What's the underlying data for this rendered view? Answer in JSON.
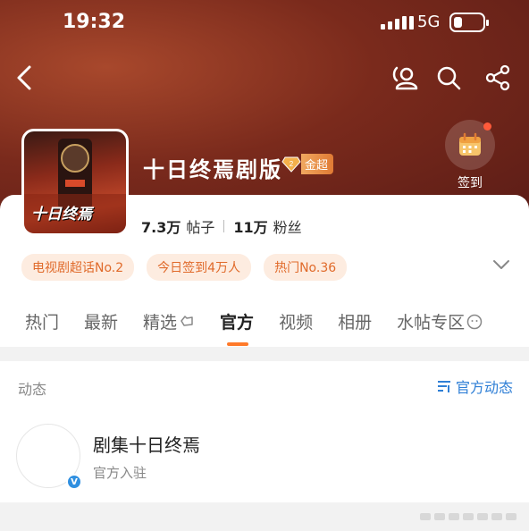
{
  "status": {
    "time": "19:32",
    "network": "5G"
  },
  "header": {
    "back_icon": "chevron-left-icon",
    "icons": [
      "members-icon",
      "search-icon",
      "share-icon"
    ]
  },
  "topic": {
    "title": "十日终焉剧版",
    "badge": "金超",
    "posts_count": "7.3万",
    "posts_label": "帖子",
    "fans_count": "11万",
    "fans_label": "粉丝",
    "checkin_label": "签到",
    "poster_text": "十日终焉"
  },
  "tags": [
    "电视剧超话No.2",
    "今日签到4万人",
    "热门No.36"
  ],
  "tabs": [
    "热门",
    "最新",
    "精选",
    "官方",
    "视频",
    "相册",
    "水帖专区"
  ],
  "active_tab": "官方",
  "section": {
    "title": "动态",
    "link": "官方动态"
  },
  "post": {
    "name": "剧集十日终焉",
    "subtitle": "官方入驻"
  },
  "colors": {
    "accent": "#ff7a2a",
    "link": "#2f7fd6",
    "tag_bg": "#fdece0",
    "tag_text": "#e06a2a"
  }
}
